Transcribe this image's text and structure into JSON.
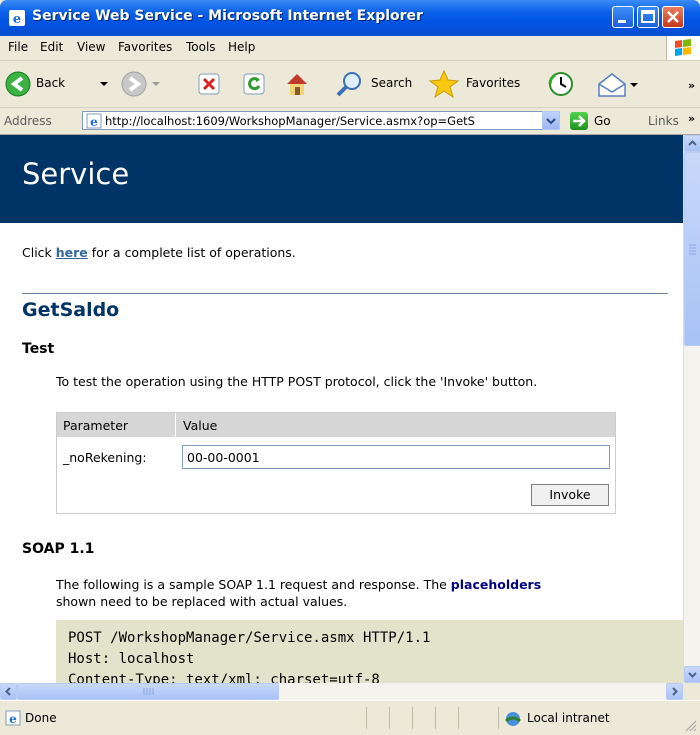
{
  "window": {
    "title": "Service Web Service - Microsoft Internet Explorer"
  },
  "menu": {
    "items": [
      "File",
      "Edit",
      "View",
      "Favorites",
      "Tools",
      "Help"
    ]
  },
  "toolbar": {
    "back": "Back",
    "search": "Search",
    "favorites": "Favorites"
  },
  "address": {
    "label": "Address",
    "url": "http://localhost:1609/WorkshopManager/Service.asmx?op=GetS",
    "go": "Go",
    "links": "Links"
  },
  "page": {
    "title": "Service",
    "intro_before": "Click ",
    "intro_link": "here",
    "intro_after": " for a complete list of operations.",
    "operation": "GetSaldo",
    "test_heading": "Test",
    "test_text": "To test the operation using the HTTP POST protocol, click the 'Invoke' button.",
    "param_header": "Parameter",
    "value_header": "Value",
    "param_name": "_noRekening:",
    "param_value": "00-00-0001",
    "invoke": "Invoke",
    "soap_heading": "SOAP 1.1",
    "soap_text_1": "The following is a sample SOAP 1.1 request and response. The ",
    "soap_placeholders": "placeholders",
    "soap_text_2": "shown need to be replaced with actual values.",
    "code_lines": [
      "POST /WorkshopManager/Service.asmx HTTP/1.1",
      "Host: localhost",
      "Content-Type: text/xml; charset=utf-8"
    ]
  },
  "status": {
    "text": "Done",
    "zone": "Local intranet"
  },
  "colors": {
    "header_bg": "#003366",
    "title_blue": "#0054E3",
    "code_bg": "#E3E3CC"
  }
}
